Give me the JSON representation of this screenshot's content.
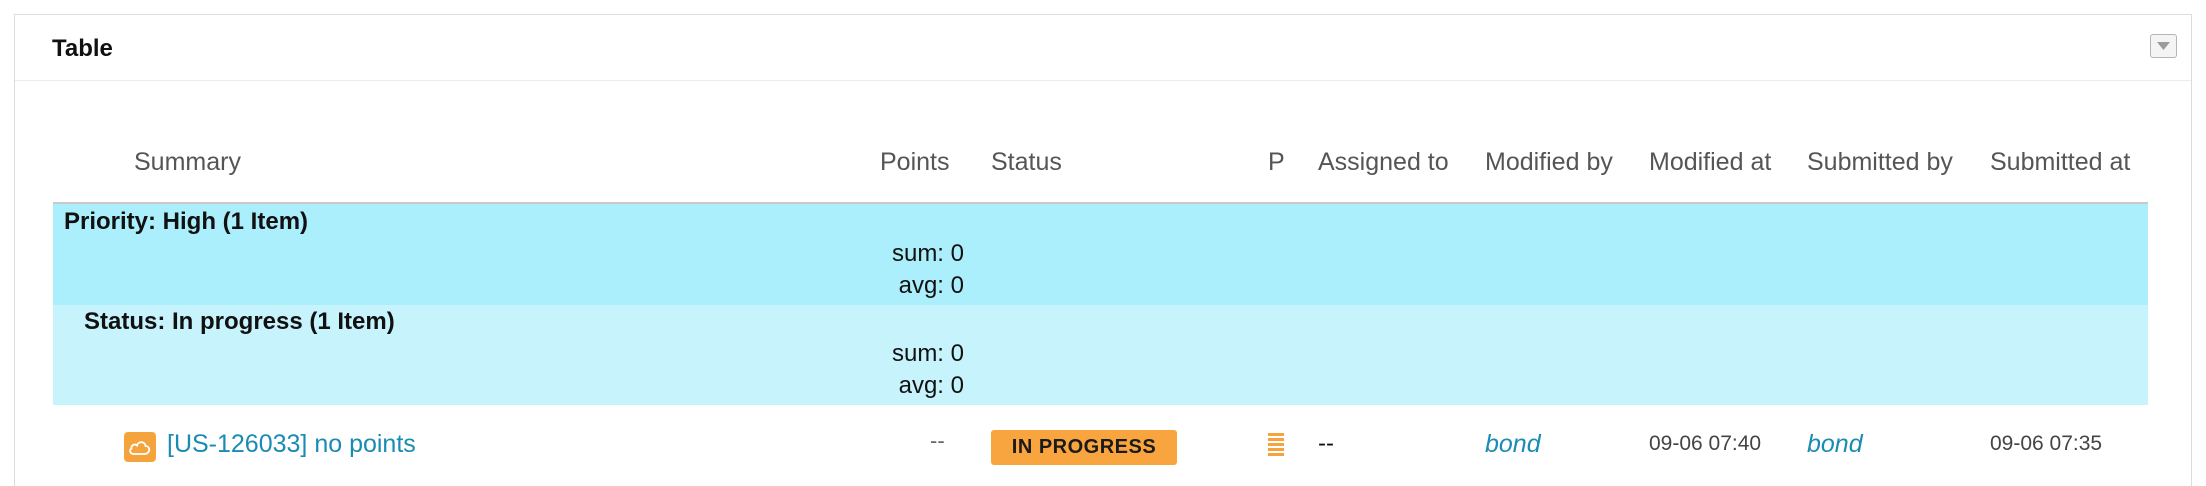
{
  "panel": {
    "title": "Table",
    "collapse_icon": "chevron-down-icon"
  },
  "columns": [
    {
      "key": "summary",
      "label": "Summary"
    },
    {
      "key": "points",
      "label": "Points"
    },
    {
      "key": "status",
      "label": "Status"
    },
    {
      "key": "priority",
      "label": "P"
    },
    {
      "key": "assigned_to",
      "label": "Assigned to"
    },
    {
      "key": "modified_by",
      "label": "Modified by"
    },
    {
      "key": "modified_at",
      "label": "Modified at"
    },
    {
      "key": "submitted_by",
      "label": "Submitted by"
    },
    {
      "key": "submitted_at",
      "label": "Submitted at"
    }
  ],
  "groups": [
    {
      "title": "Priority: High (1 Item)",
      "sum": "sum: 0",
      "avg": "avg: 0",
      "color": "#abeefc",
      "subgroups": [
        {
          "title": "Status: In progress (1 Item)",
          "sum": "sum: 0",
          "avg": "avg: 0",
          "color": "#c7f3fd",
          "rows": [
            {
              "type_icon": "user-story-icon",
              "summary": "[US-126033] no points",
              "points": "--",
              "status": "IN PROGRESS",
              "status_color": "#f9a53f",
              "priority_icon": "priority-high-icon",
              "assigned_to": "--",
              "modified_by": "bond",
              "modified_at": "09-06 07:40",
              "submitted_by": "bond",
              "submitted_at": "09-06 07:35"
            }
          ]
        }
      ]
    }
  ]
}
